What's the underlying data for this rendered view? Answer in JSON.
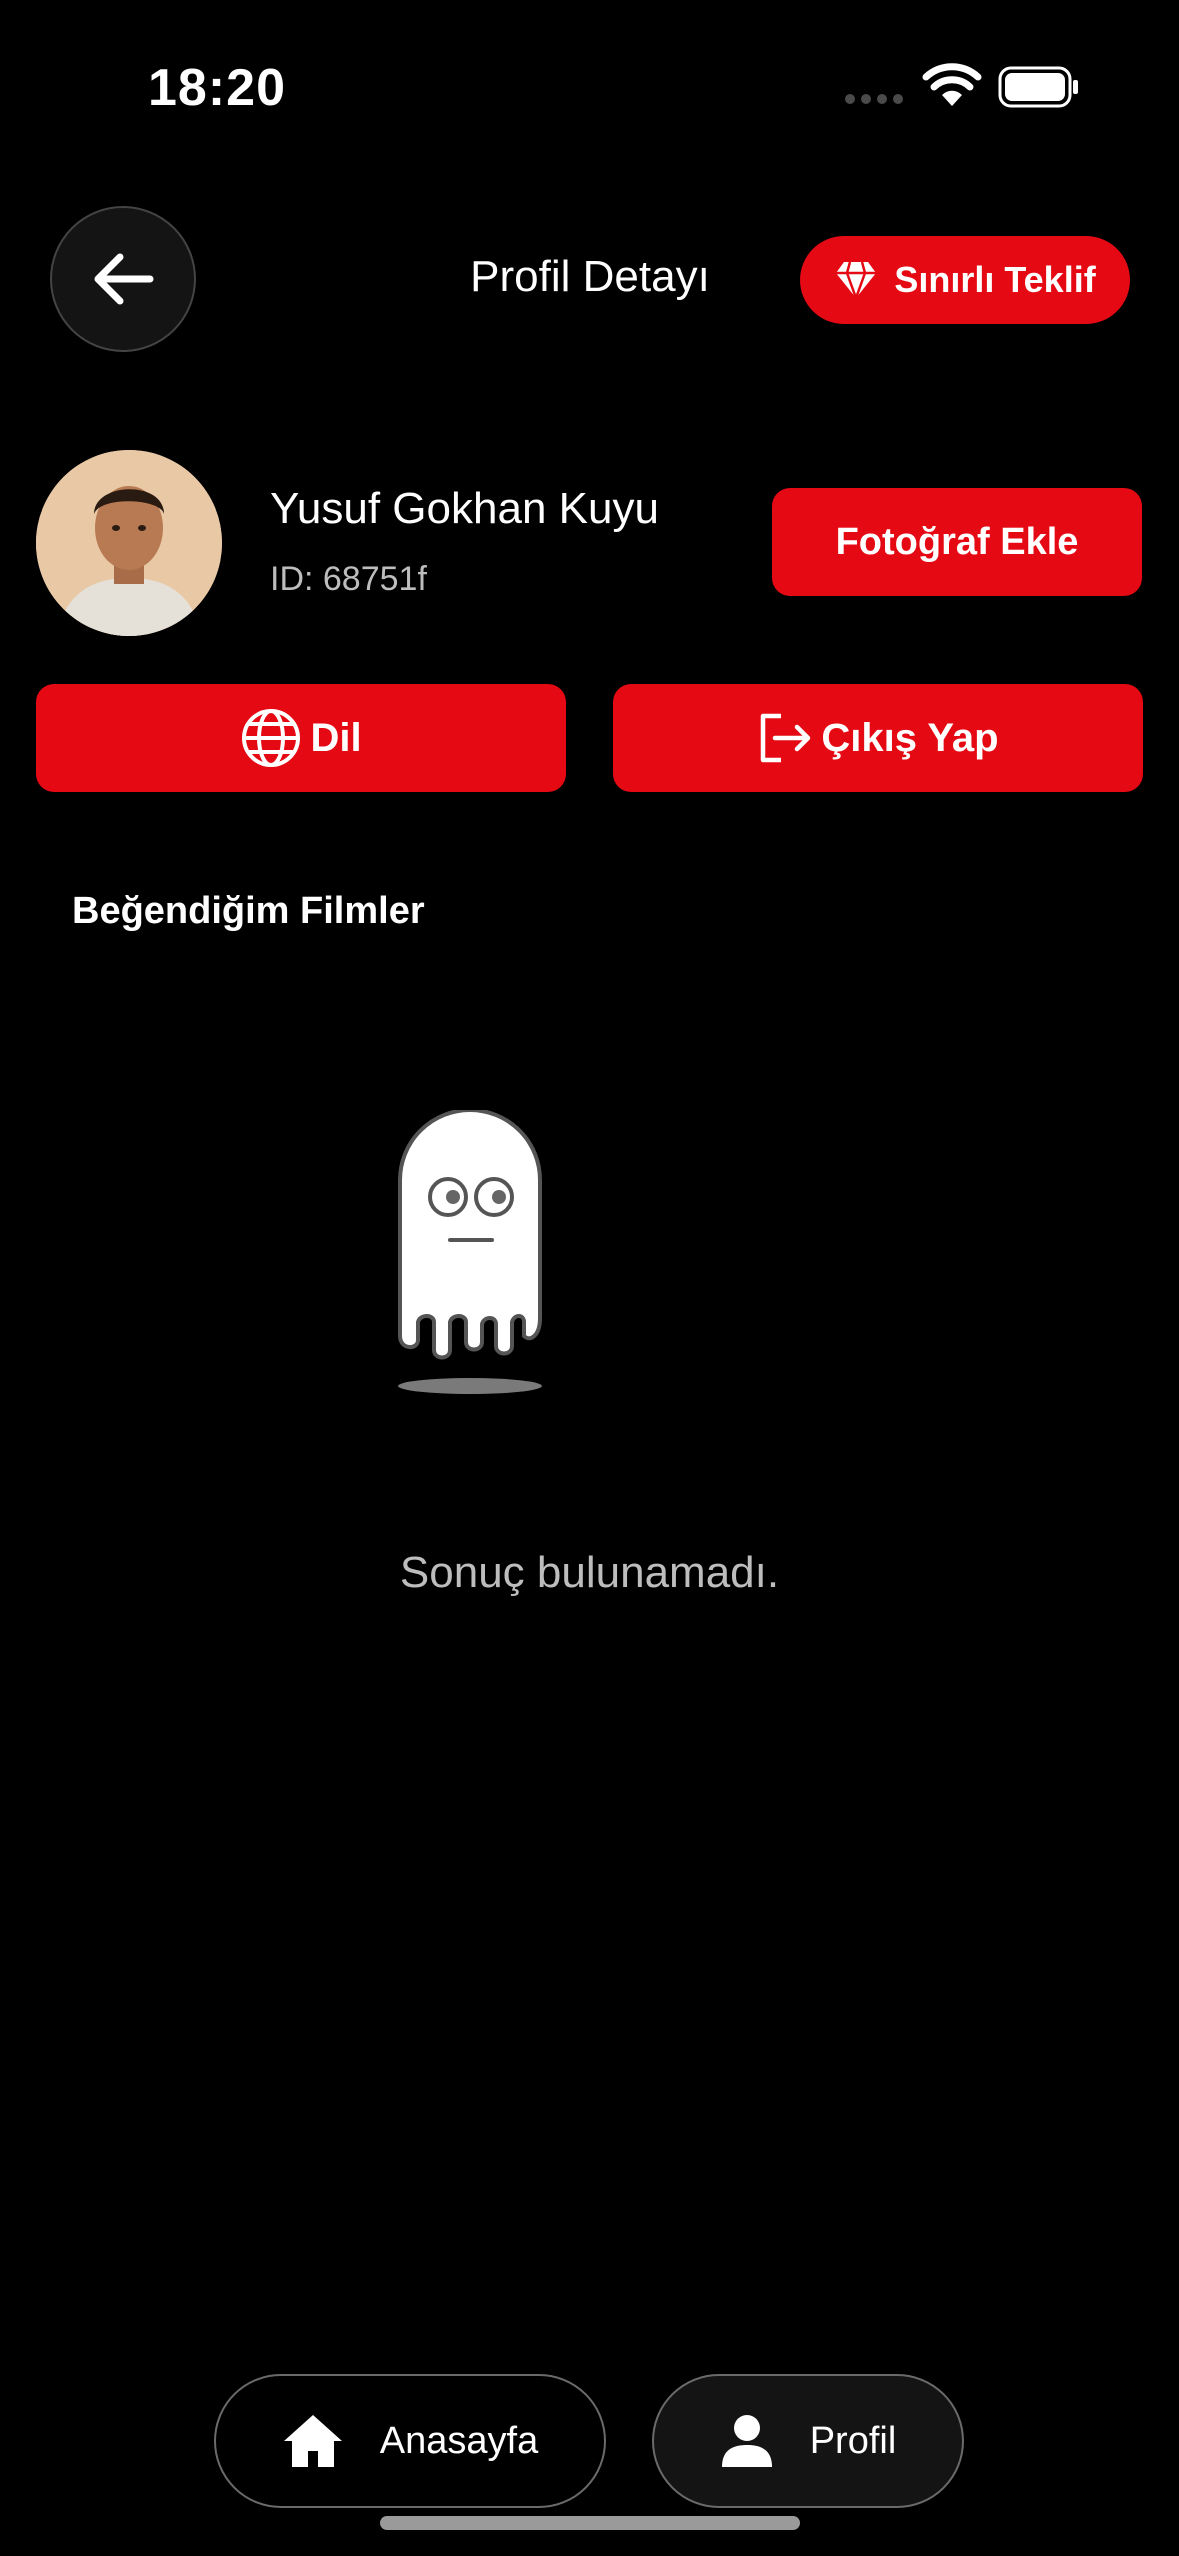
{
  "status_bar": {
    "time": "18:20"
  },
  "header": {
    "title": "Profil Detayı",
    "offer_label": "Sınırlı Teklif"
  },
  "profile": {
    "name": "Yusuf Gokhan Kuyu",
    "id_text": "ID: 68751f",
    "add_photo_label": "Fotoğraf Ekle"
  },
  "actions": {
    "language_label": "Dil",
    "logout_label": "Çıkış Yap"
  },
  "favorites": {
    "title": "Beğendiğim Filmler",
    "empty_text": "Sonuç bulunamadı."
  },
  "bottom_nav": {
    "home_label": "Anasayfa",
    "profile_label": "Profil"
  },
  "colors": {
    "accent": "#e50914",
    "background": "#000000",
    "muted_text": "#bdbdbd"
  },
  "icons": [
    "back-arrow-icon",
    "diamond-icon",
    "globe-icon",
    "logout-icon",
    "ghost-icon",
    "home-icon",
    "person-icon",
    "wifi-icon",
    "battery-icon"
  ]
}
